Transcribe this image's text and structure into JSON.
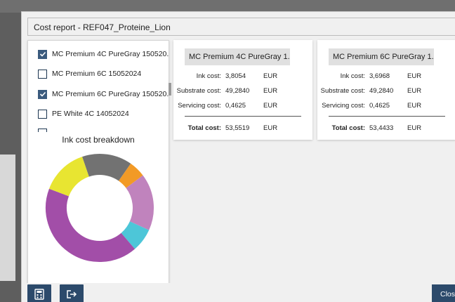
{
  "dialog": {
    "title": "Cost report - REF047_Proteine_Lion"
  },
  "lots": [
    {
      "label": "MC Premium 4C PureGray 150520...",
      "checked": true
    },
    {
      "label": "MC Premium 6C 15052024",
      "checked": false
    },
    {
      "label": "MC Premium 6C PureGray 150520...",
      "checked": true
    },
    {
      "label": "PE White 4C 14052024",
      "checked": false
    }
  ],
  "chart": {
    "title": "Ink cost breakdown",
    "chart_data": {
      "type": "pie",
      "title": "Ink cost breakdown",
      "style": "donut",
      "slices": [
        {
          "color": "#f29a26",
          "value": 0.05
        },
        {
          "color": "#c083bd",
          "value": 0.17
        },
        {
          "color": "#4dc6d8",
          "value": 0.07
        },
        {
          "color": "#a24ea8",
          "value": 0.42
        },
        {
          "color": "#e8e531",
          "value": 0.14
        },
        {
          "color": "#727272",
          "value": 0.15
        }
      ]
    }
  },
  "cards": [
    {
      "header": "MC Premium 4C PureGray 1...",
      "ink_label": "Ink cost:",
      "ink_value": "3,8054",
      "ink_unit": "EUR",
      "substrate_label": "Substrate cost:",
      "substrate_value": "49,2840",
      "substrate_unit": "EUR",
      "servicing_label": "Servicing cost:",
      "servicing_value": "0,4625",
      "servicing_unit": "EUR",
      "total_label": "Total cost:",
      "total_value": "53,5519",
      "total_unit": "EUR"
    },
    {
      "header": "MC Premium 6C PureGray 1...",
      "ink_label": "Ink cost:",
      "ink_value": "3,6968",
      "ink_unit": "EUR",
      "substrate_label": "Substrate cost:",
      "substrate_value": "49,2840",
      "substrate_unit": "EUR",
      "servicing_label": "Servicing cost:",
      "servicing_value": "0,4625",
      "servicing_unit": "EUR",
      "total_label": "Total cost:",
      "total_value": "53,4433",
      "total_unit": "EUR"
    }
  ],
  "footer": {
    "calculator_icon": "calculator-icon",
    "export_icon": "export-icon",
    "close_label": "Close"
  },
  "colors": {
    "accent": "#2c4a6b",
    "checkbox": "#3b5b7e"
  }
}
